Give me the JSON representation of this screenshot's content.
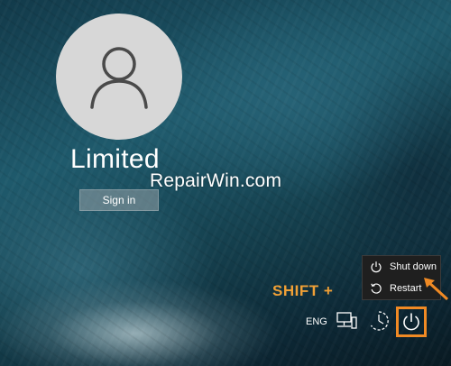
{
  "account": {
    "username": "Limited",
    "sign_in_label": "Sign in"
  },
  "watermark": {
    "text": "RepairWin.com"
  },
  "power_menu": {
    "items": [
      {
        "label": "Shut down",
        "icon": "shut-down-icon"
      },
      {
        "label": "Restart",
        "icon": "restart-icon"
      }
    ]
  },
  "annotation": {
    "shift_text": "SHIFT +",
    "color": "#f08a24"
  },
  "tray": {
    "language": "ENG",
    "icons": [
      "network-icon",
      "ease-of-access-icon",
      "power-icon"
    ]
  }
}
